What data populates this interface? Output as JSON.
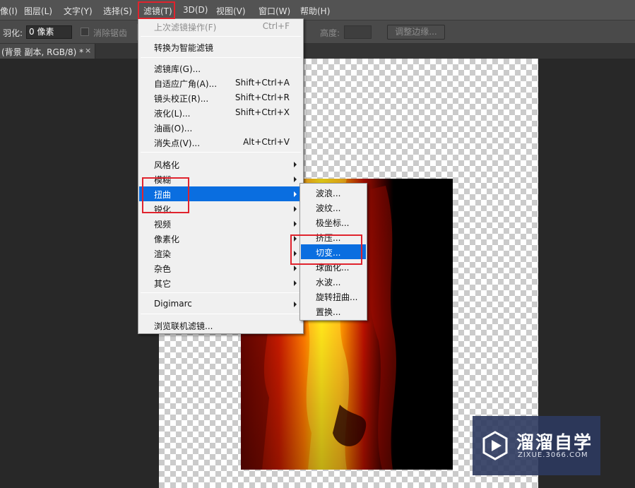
{
  "menubar": {
    "items": [
      {
        "label": "像(I)"
      },
      {
        "label": "图层(L)"
      },
      {
        "label": "文字(Y)"
      },
      {
        "label": "选择(S)"
      },
      {
        "label": "滤镜(T)"
      },
      {
        "label": "3D(D)"
      },
      {
        "label": "视图(V)"
      },
      {
        "label": "窗口(W)"
      },
      {
        "label": "帮助(H)"
      }
    ]
  },
  "options": {
    "feather_label": "羽化:",
    "feather_value": "0 像素",
    "antialias_label": "消除锯齿",
    "height_label": "高度:",
    "refine_edge_label": "调整边缘..."
  },
  "document_tab": {
    "title": "(背景 副本, RGB/8) *",
    "close_glyph": "×"
  },
  "filter_menu": {
    "items": [
      {
        "label": "上次滤镜操作(F)",
        "shortcut": "Ctrl+F"
      },
      {
        "label": "转换为智能滤镜"
      },
      {
        "label": "滤镜库(G)..."
      },
      {
        "label": "自适应广角(A)...",
        "shortcut": "Shift+Ctrl+A"
      },
      {
        "label": "镜头校正(R)...",
        "shortcut": "Shift+Ctrl+R"
      },
      {
        "label": "液化(L)...",
        "shortcut": "Shift+Ctrl+X"
      },
      {
        "label": "油画(O)..."
      },
      {
        "label": "消失点(V)...",
        "shortcut": "Alt+Ctrl+V"
      },
      {
        "label": "风格化"
      },
      {
        "label": "模糊"
      },
      {
        "label": "扭曲"
      },
      {
        "label": "锐化"
      },
      {
        "label": "视频"
      },
      {
        "label": "像素化"
      },
      {
        "label": "渲染"
      },
      {
        "label": "杂色"
      },
      {
        "label": "其它"
      },
      {
        "label": "Digimarc"
      },
      {
        "label": "浏览联机滤镜..."
      }
    ]
  },
  "distort_submenu": {
    "items": [
      {
        "label": "波浪..."
      },
      {
        "label": "波纹..."
      },
      {
        "label": "极坐标..."
      },
      {
        "label": "挤压..."
      },
      {
        "label": "切变..."
      },
      {
        "label": "球面化..."
      },
      {
        "label": "水波..."
      },
      {
        "label": "旋转扭曲..."
      },
      {
        "label": "置换..."
      }
    ]
  },
  "watermark": {
    "name": "溜溜自学",
    "url": "ZIXUE.3066.COM"
  },
  "colors": {
    "highlight": "#0a6ee0",
    "annotation_red": "#e0232d"
  }
}
